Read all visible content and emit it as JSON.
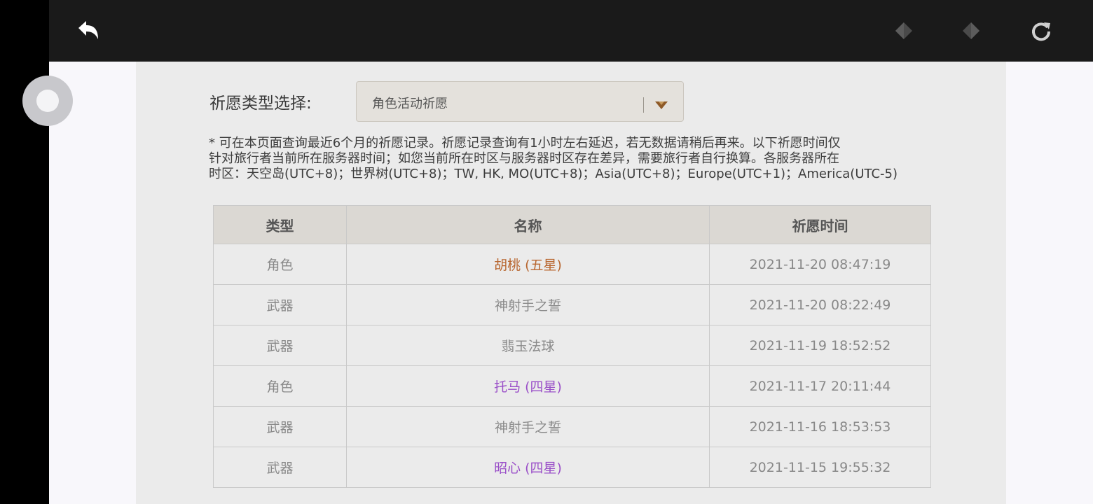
{
  "colors": {
    "five_star": "#b8662f",
    "four_star": "#9a4fc8",
    "three_star": "#8a8a8a"
  },
  "toolbar": {
    "back_icon": "back-arrow-icon",
    "prev_icon": "left-diamond-icon",
    "next_icon": "right-diamond-icon",
    "reload_icon": "reload-icon"
  },
  "filter": {
    "label": "祈愿类型选择:",
    "selected": "角色活动祈愿"
  },
  "notice": "* 可在本页面查询最近6个月的祈愿记录。祈愿记录查询有1小时左右延迟，若无数据请稍后再来。以下祈愿时间仅\n针对旅行者当前所在服务器时间；如您当前所在时区与服务器时区存在差异，需要旅行者自行换算。各服务器所在\n时区：天空岛(UTC+8)；世界树(UTC+8)；TW, HK, MO(UTC+8)；Asia(UTC+8)；Europe(UTC+1)；America(UTC-5)",
  "table": {
    "headers": [
      "类型",
      "名称",
      "祈愿时间"
    ],
    "rows": [
      {
        "type": "角色",
        "name": "胡桃 (五星)",
        "time": "2021-11-20 08:47:19",
        "rarity": "five"
      },
      {
        "type": "武器",
        "name": "神射手之誓",
        "time": "2021-11-20 08:22:49",
        "rarity": "three"
      },
      {
        "type": "武器",
        "name": "翡玉法球",
        "time": "2021-11-19 18:52:52",
        "rarity": "three"
      },
      {
        "type": "角色",
        "name": "托马 (四星)",
        "time": "2021-11-17 20:11:44",
        "rarity": "four"
      },
      {
        "type": "武器",
        "name": "神射手之誓",
        "time": "2021-11-16 18:53:53",
        "rarity": "three"
      },
      {
        "type": "武器",
        "name": "昭心 (四星)",
        "time": "2021-11-15 19:55:32",
        "rarity": "four"
      }
    ]
  }
}
